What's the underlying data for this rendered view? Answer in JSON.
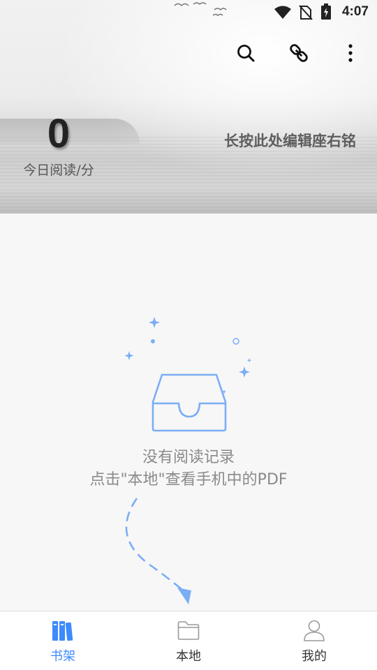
{
  "status_bar": {
    "time": "4:07",
    "icons": [
      "wifi-icon",
      "no-sim-icon",
      "battery-charging-icon"
    ]
  },
  "toolbar": {
    "icons": [
      "search-icon",
      "link-icon",
      "more-vert-icon"
    ]
  },
  "header": {
    "reading_minutes": "0",
    "reading_label": "今日阅读/分",
    "motto": "长按此处编辑座右铭"
  },
  "empty_state": {
    "title": "没有阅读记录",
    "hint": "点击\"本地\"查看手机中的PDF",
    "icon": "empty-inbox-icon",
    "accent_color": "#7aaef5"
  },
  "bottom_nav": {
    "items": [
      {
        "label": "书架",
        "icon": "bookshelf-icon",
        "active": true
      },
      {
        "label": "本地",
        "icon": "folder-icon",
        "active": false
      },
      {
        "label": "我的",
        "icon": "profile-icon",
        "active": false
      }
    ],
    "active_color": "#3d8bfd"
  }
}
